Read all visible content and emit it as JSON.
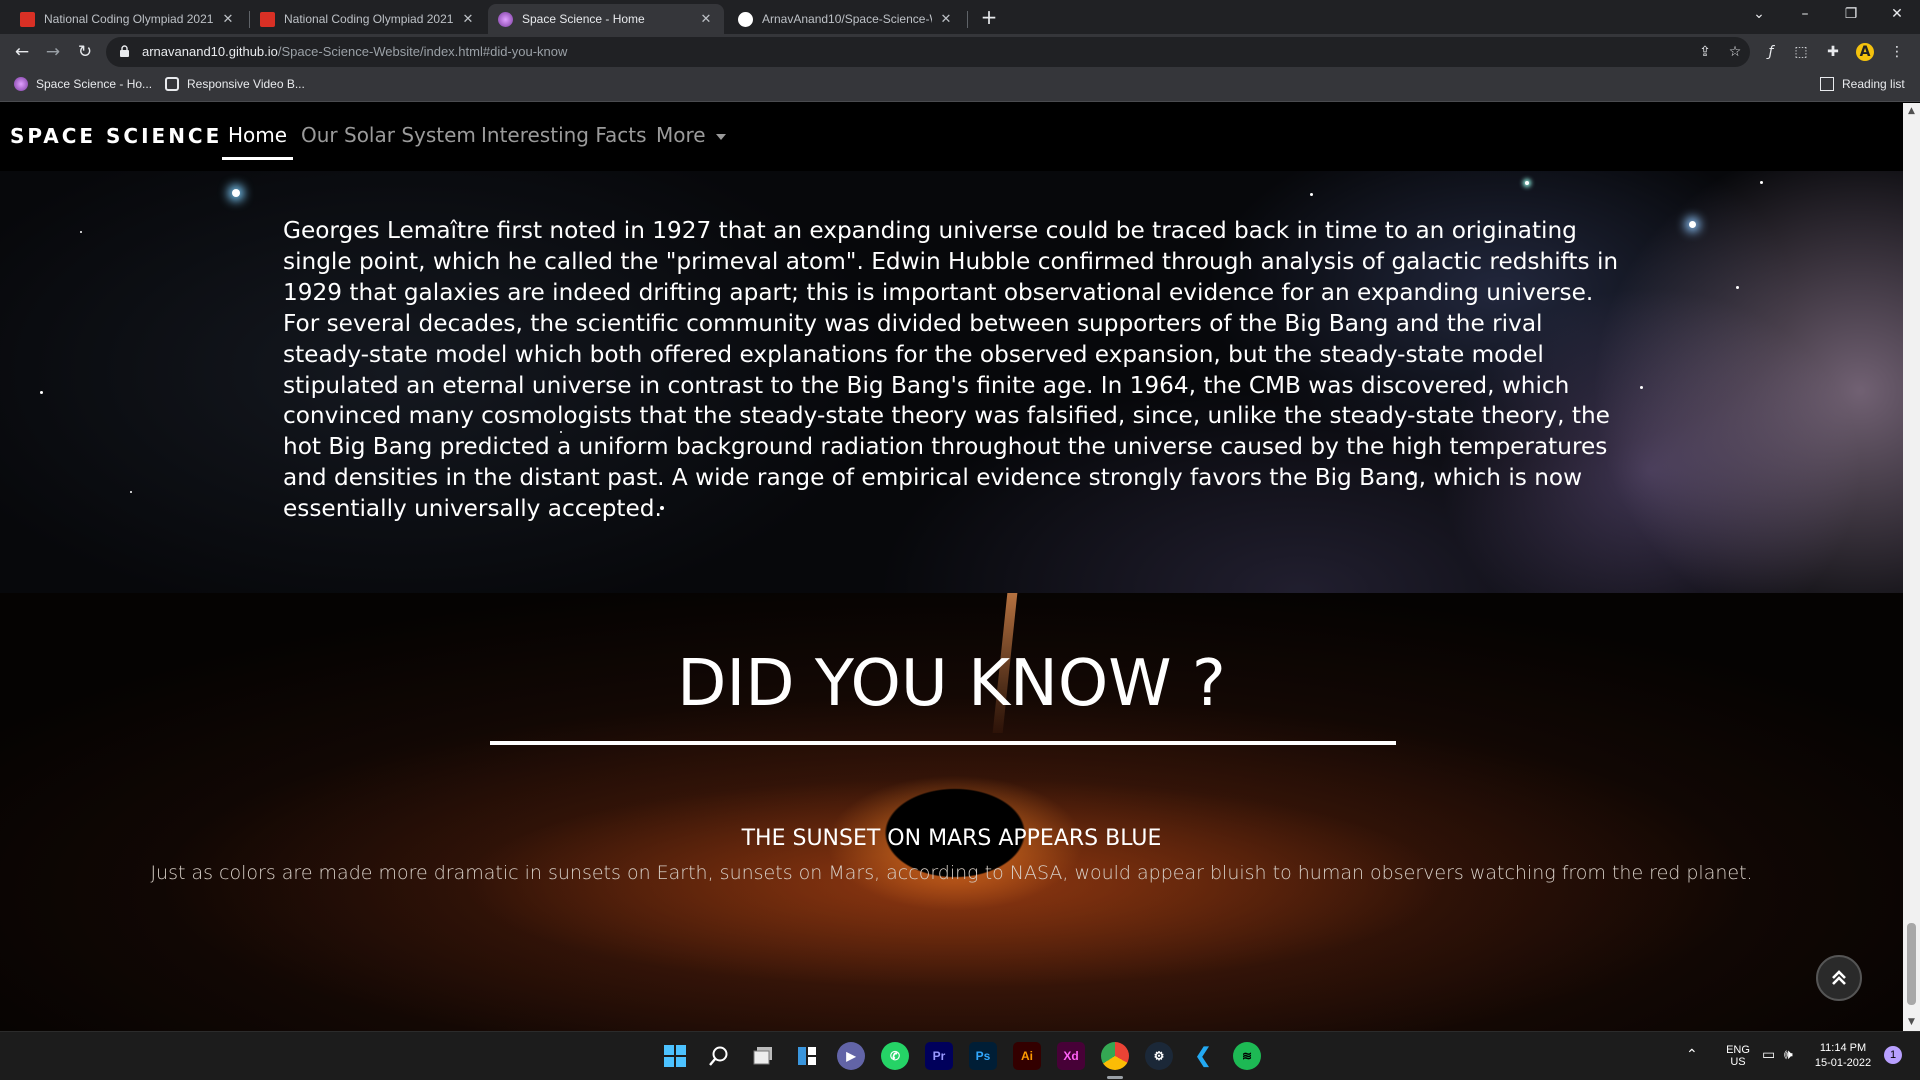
{
  "browser": {
    "tabs": [
      {
        "title": "National Coding Olympiad 2021",
        "active": false
      },
      {
        "title": "National Coding Olympiad 2021",
        "active": false
      },
      {
        "title": "Space Science - Home",
        "active": true
      },
      {
        "title": "ArnavAnand10/Space-Science-W",
        "active": false
      }
    ],
    "new_tab": "+",
    "url_host": "arnavanand10.github.io",
    "url_path": "/Space-Science-Website/index.html#did-you-know",
    "bookmarks": [
      {
        "label": "Space Science - Ho..."
      },
      {
        "label": "Responsive Video B..."
      }
    ],
    "reading_list": "Reading list",
    "profile_initial": "A"
  },
  "site": {
    "brand": "SPACE SCIENCE",
    "nav": {
      "home": "Home",
      "solar_system": "Our Solar System",
      "facts": "Interesting Facts",
      "more": "More"
    },
    "history_paragraph": "Georges Lemaître first noted in 1927 that an expanding universe could be traced back in time to an originating single point, which he called the \"primeval atom\". Edwin Hubble confirmed through analysis of galactic redshifts in 1929 that galaxies are indeed drifting apart; this is important observational evidence for an expanding universe. For several decades, the scientific community was divided between supporters of the Big Bang and the rival steady-state model which both offered explanations for the observed expansion, but the steady-state model stipulated an eternal universe in contrast to the Big Bang's finite age. In 1964, the CMB was discovered, which convinced many cosmologists that the steady-state theory was falsified, since, unlike the steady-state theory, the hot Big Bang predicted a uniform background radiation throughout the universe caused by the high temperatures and densities in the distant past. A wide range of empirical evidence strongly favors the Big Bang, which is now essentially universally accepted.",
    "did_you_know": {
      "heading": "DID YOU KNOW ?",
      "fact_title": "THE SUNSET ON MARS APPEARS BLUE",
      "fact_body": "Just as colors are made more dramatic in sunsets on Earth, sunsets on Mars, according to NASA, would appear bluish to human observers watching from the red planet."
    }
  },
  "taskbar": {
    "apps": [
      "windows-start",
      "search",
      "task-view",
      "widgets",
      "teams-chat",
      "whatsapp",
      "premiere-pro",
      "photoshop",
      "illustrator",
      "xd",
      "chrome",
      "steam",
      "vscode",
      "spotify"
    ],
    "labels": {
      "premiere": "Pr",
      "photoshop": "Ps",
      "illustrator": "Ai",
      "xd": "Xd"
    },
    "lang_top": "ENG",
    "lang_bottom": "US",
    "time": "11:14 PM",
    "date": "15-01-2022",
    "notification_count": "1"
  },
  "colors": {
    "tabstrip": "#202124",
    "toolbar": "#35363a",
    "page_bg": "#000000",
    "text": "#ffffff",
    "nav_inactive": "#9a9a9a"
  }
}
